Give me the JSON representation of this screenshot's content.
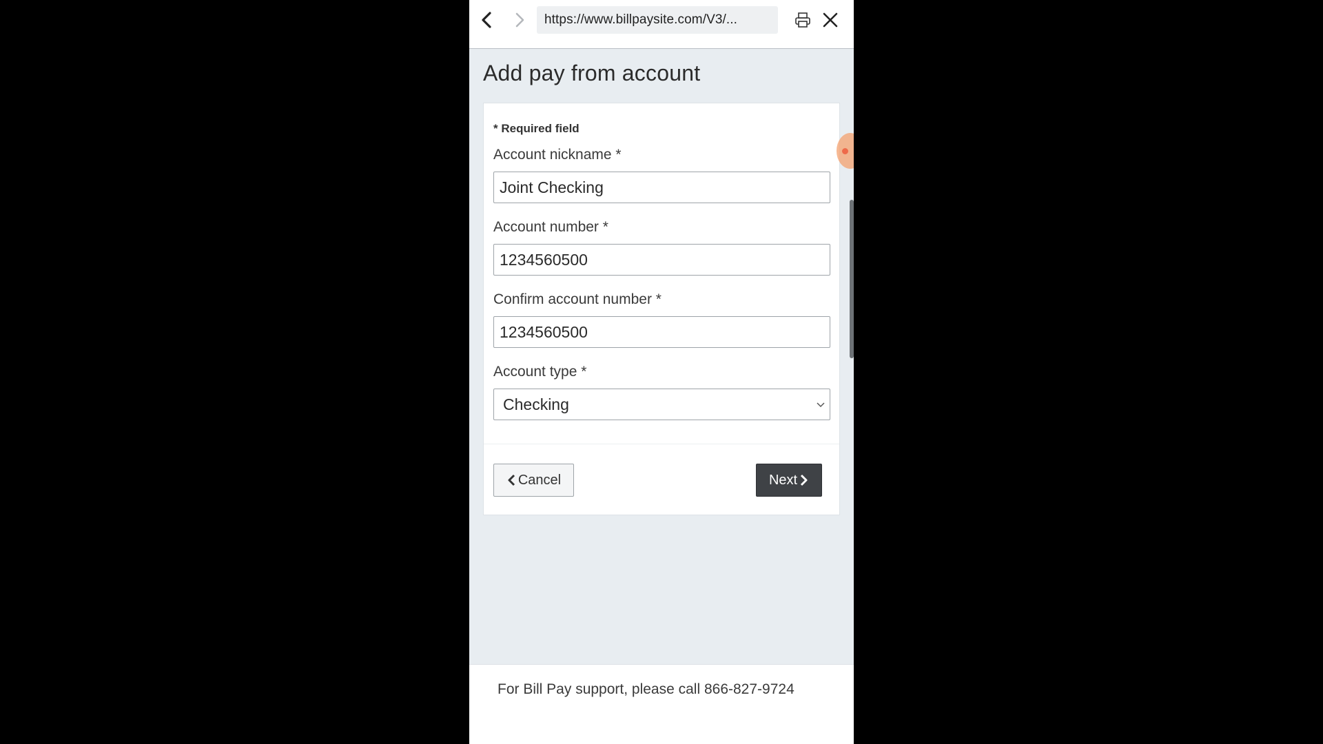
{
  "browser": {
    "url": "https://www.billpaysite.com/V3/...",
    "icons": [
      "back-arrow-icon",
      "forward-arrow-icon",
      "printer-icon",
      "close-icon"
    ]
  },
  "page": {
    "title": "Add pay from account"
  },
  "form": {
    "required_note": "* Required field",
    "nickname": {
      "label": "Account nickname *",
      "value": "Joint Checking"
    },
    "account_number": {
      "label": "Account number *",
      "value": "1234560500"
    },
    "confirm_account_number": {
      "label": "Confirm account number *",
      "value": "1234560500"
    },
    "account_type": {
      "label": "Account type *",
      "selected": "Checking"
    },
    "cancel_label": "Cancel",
    "next_label": "Next"
  },
  "footer": {
    "support_text": "For Bill Pay support, please call 866-827-9724"
  },
  "colors": {
    "page_background": "#e8edf1",
    "next_button": "#3f4246",
    "touch_indicator": "#f4a06e"
  }
}
